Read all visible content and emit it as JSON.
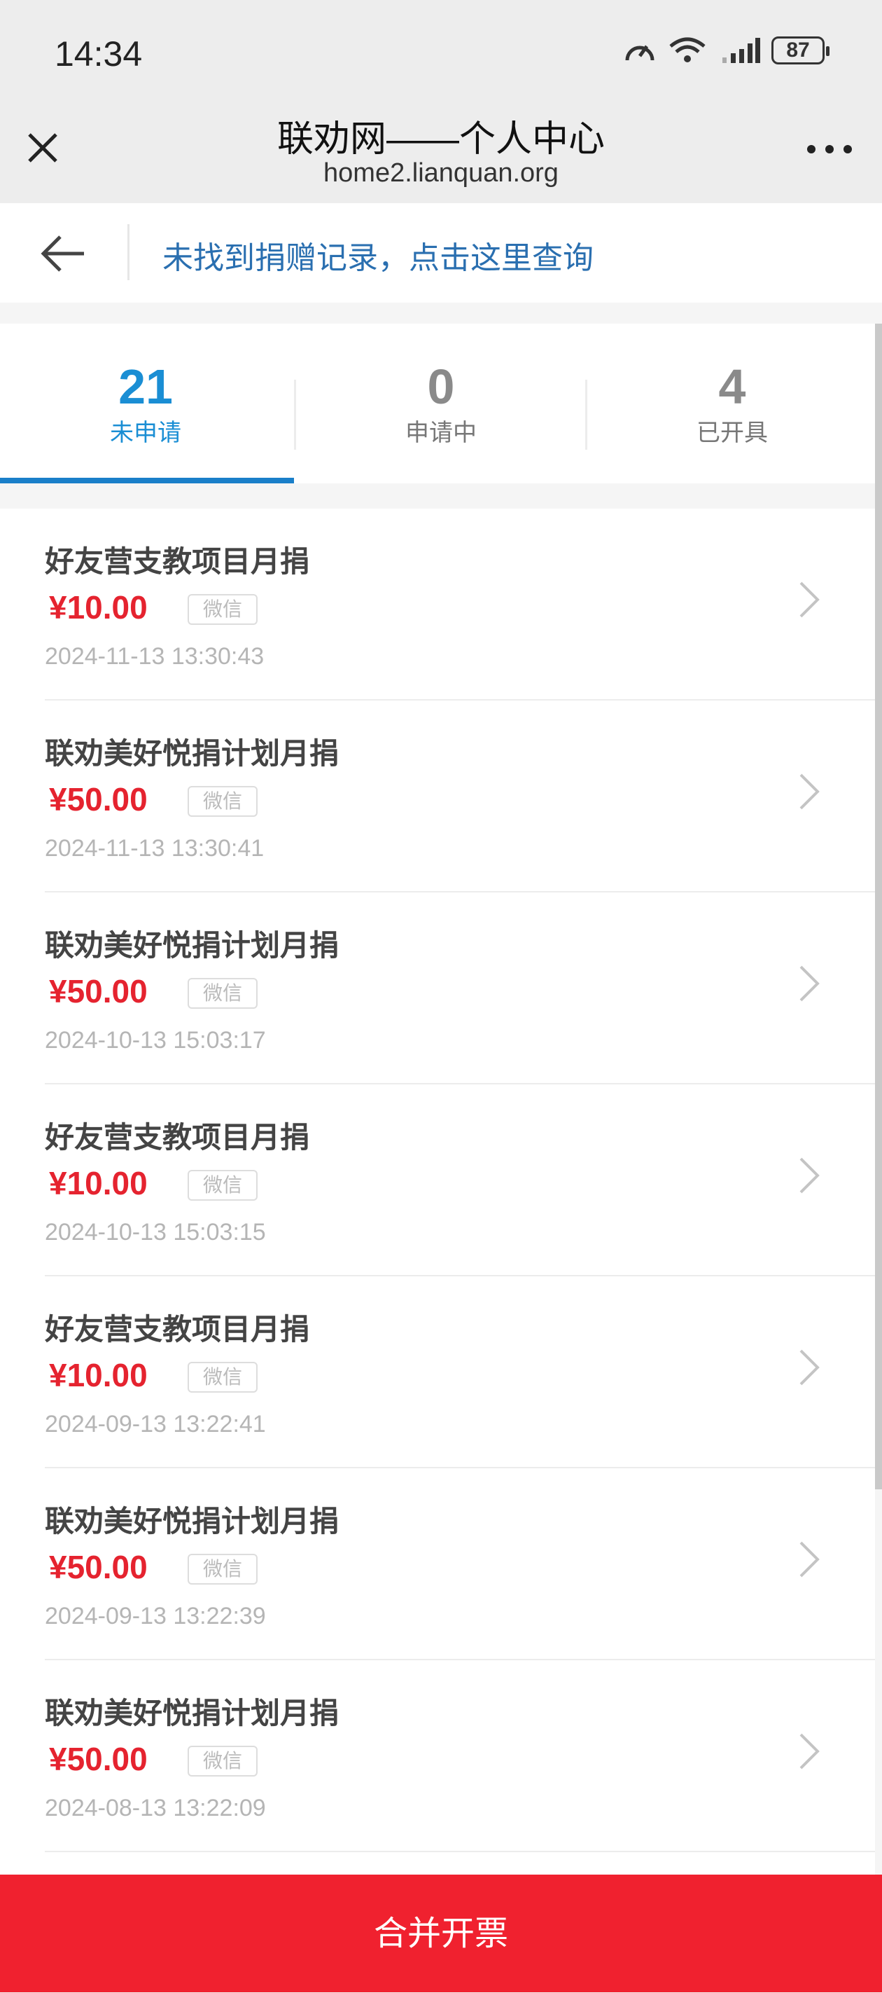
{
  "status_bar": {
    "time": "14:34",
    "battery": "87"
  },
  "header": {
    "title": "联劝网——个人中心",
    "url": "home2.lianquan.org"
  },
  "notice": {
    "link_text": "未找到捐赠记录，点击这里查询"
  },
  "tabs": [
    {
      "count": "21",
      "label": "未申请",
      "active": true
    },
    {
      "count": "0",
      "label": "申请中",
      "active": false
    },
    {
      "count": "4",
      "label": "已开具",
      "active": false
    }
  ],
  "records": [
    {
      "title": "好友营支教项目月捐",
      "amount": "¥10.00",
      "method": "微信",
      "time": "2024-11-13 13:30:43"
    },
    {
      "title": "联劝美好悦捐计划月捐",
      "amount": "¥50.00",
      "method": "微信",
      "time": "2024-11-13 13:30:41"
    },
    {
      "title": "联劝美好悦捐计划月捐",
      "amount": "¥50.00",
      "method": "微信",
      "time": "2024-10-13 15:03:17"
    },
    {
      "title": "好友营支教项目月捐",
      "amount": "¥10.00",
      "method": "微信",
      "time": "2024-10-13 15:03:15"
    },
    {
      "title": "好友营支教项目月捐",
      "amount": "¥10.00",
      "method": "微信",
      "time": "2024-09-13 13:22:41"
    },
    {
      "title": "联劝美好悦捐计划月捐",
      "amount": "¥50.00",
      "method": "微信",
      "time": "2024-09-13 13:22:39"
    },
    {
      "title": "联劝美好悦捐计划月捐",
      "amount": "¥50.00",
      "method": "微信",
      "time": "2024-08-13 13:22:09"
    }
  ],
  "footer": {
    "merge_label": "合并开票"
  },
  "colors": {
    "accent_blue": "#1a8ed4",
    "amount_red": "#e5232f",
    "button_red": "#f0212f"
  }
}
